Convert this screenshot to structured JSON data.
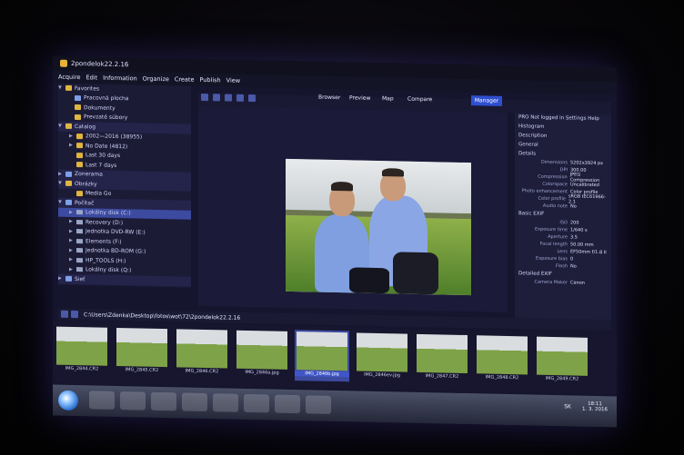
{
  "window": {
    "title": "2pondelok22.2.16"
  },
  "menu": [
    "Acquire",
    "Edit",
    "Information",
    "Organize",
    "Create",
    "Publish",
    "View"
  ],
  "tree": {
    "favorites": {
      "label": "Favorites",
      "items": [
        "Pracovná plocha",
        "Dokumenty",
        "Prevzaté súbory"
      ]
    },
    "catalog": {
      "label": "Catalog",
      "items": [
        "2002—2016 (38955)",
        "No Date (4812)",
        "Last 30 days",
        "Last 7 days"
      ]
    },
    "zonerama": "Zonerama",
    "obrazky": {
      "label": "Obrázky",
      "items": [
        "Media Go"
      ]
    },
    "pocitac": {
      "label": "Počítač",
      "items": [
        "Lokálny disk (C:)",
        "Recovery (D:)",
        "Jednotka DVD-RW (E:)",
        "Elements (F:)",
        "Jednotka BD-ROM (G:)",
        "HP_TOOLS (H:)",
        "Lokálny disk (Q:)"
      ]
    },
    "siet": "Sieť"
  },
  "view_tabs": [
    "Browser",
    "Preview",
    "Map",
    "Compare"
  ],
  "manager_label": "Manager",
  "right_panel": {
    "header": "PRO",
    "login": "Not logged in",
    "settings": "Settings",
    "help": "Help",
    "sections": [
      "Histogram",
      "Description",
      "General",
      "Details"
    ],
    "details": [
      {
        "k": "Dimensions",
        "v": "5202x3924 px"
      },
      {
        "k": "DPI",
        "v": "300.00"
      },
      {
        "k": "Compression",
        "v": "JPEG Compression"
      },
      {
        "k": "Colorspace",
        "v": "Uncalibrated"
      },
      {
        "k": "Photo enhancement",
        "v": "Color profile"
      },
      {
        "k": "Color profile",
        "v": "sRGB IEC61966-2.1"
      },
      {
        "k": "Audio note",
        "v": "No"
      }
    ],
    "basic_exif": "Basic EXIF",
    "exif": [
      {
        "k": "ISO",
        "v": "200"
      },
      {
        "k": "Exposure time",
        "v": "1/640 s"
      },
      {
        "k": "Aperture",
        "v": "3.5"
      },
      {
        "k": "Focal length",
        "v": "50.00 mm"
      },
      {
        "k": "Lens",
        "v": "EF50mm f/1.8 II"
      },
      {
        "k": "Exposure bias",
        "v": "0"
      },
      {
        "k": "Flash",
        "v": "No"
      }
    ],
    "detailed_exif": "Detailed EXIF",
    "camera_maker": {
      "k": "Camera Maker",
      "v": "Canon"
    }
  },
  "path": "C:\\Users\\Zdenka\\Desktop\\fotos\\wot\\72\\2pondelok22.2.16",
  "thumbs": [
    "IMG_2844.CR2",
    "IMG_2845.CR2",
    "IMG_2846.CR2",
    "IMG_2846a.jpg",
    "IMG_2846b.jpg",
    "IMG_2846ev.jpg",
    "IMG_2847.CR2",
    "IMG_2848.CR2",
    "IMG_2849.CR2"
  ],
  "thumbs_selected_index": 4,
  "taskbar": {
    "lang": "SK",
    "time": "18:11",
    "date": "1. 3. 2016"
  }
}
